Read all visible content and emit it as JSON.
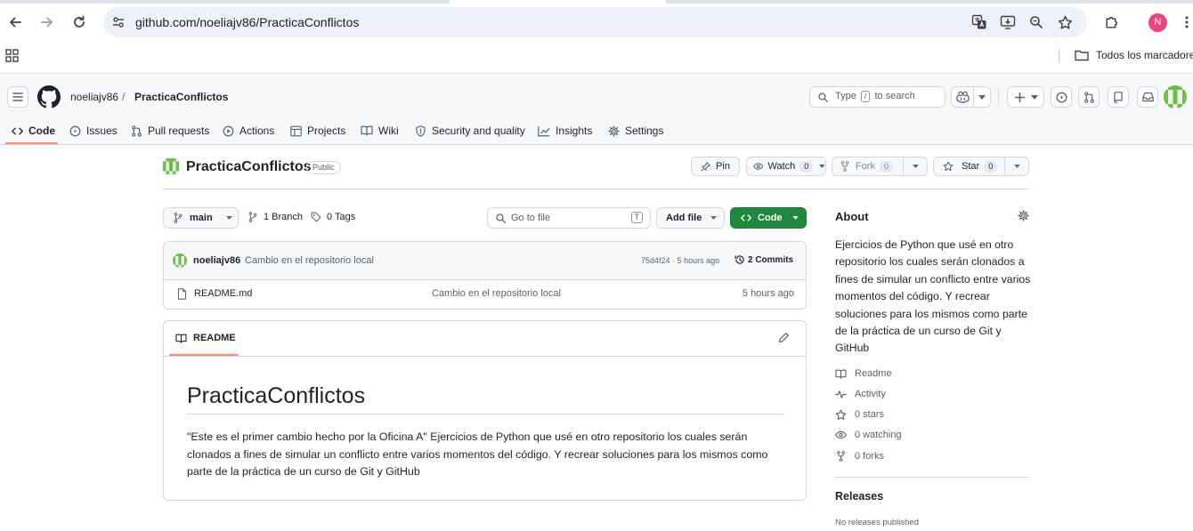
{
  "browser": {
    "url": "github.com/noeliajv86/PracticaConflictos",
    "profile_initial": "N",
    "bookmarks_folder": "Todos los marcadore"
  },
  "header": {
    "owner": "noeliajv86",
    "separator": "/",
    "repo": "PracticaConflictos",
    "search": {
      "prefix": "Type",
      "key": "/",
      "suffix": "to search"
    }
  },
  "repo_nav": {
    "tabs": [
      {
        "label": "Code",
        "icon": "code-icon"
      },
      {
        "label": "Issues",
        "icon": "issue-icon"
      },
      {
        "label": "Pull requests",
        "icon": "pull-request-icon"
      },
      {
        "label": "Actions",
        "icon": "play-icon"
      },
      {
        "label": "Projects",
        "icon": "table-icon"
      },
      {
        "label": "Wiki",
        "icon": "book-icon"
      },
      {
        "label": "Security and quality",
        "icon": "shield-icon"
      },
      {
        "label": "Insights",
        "icon": "graph-icon"
      },
      {
        "label": "Settings",
        "icon": "gear-icon"
      }
    ]
  },
  "repo": {
    "name": "PracticaConflictos",
    "visibility": "Public",
    "pin_label": "Pin",
    "watch_label": "Watch",
    "watch_count": "0",
    "fork_label": "Fork",
    "fork_count": "0",
    "star_label": "Star",
    "star_count": "0"
  },
  "toolbar": {
    "branch": "main",
    "branches": "1 Branch",
    "tags": "0 Tags",
    "go_to_file": "Go to file",
    "go_to_file_key": "T",
    "add_file": "Add file",
    "code": "Code"
  },
  "latest_commit": {
    "author": "noeliajv86",
    "message": "Cambio en el repositorio local",
    "sha": "75d4f24",
    "sep": "·",
    "time": "5 hours ago",
    "commits": "2 Commits"
  },
  "files": [
    {
      "name": "README.md",
      "message": "Cambio en el repositorio local",
      "time": "5 hours ago"
    }
  ],
  "readme": {
    "tab_label": "README",
    "heading": "PracticaConflictos",
    "body": "\"Este es el primer cambio hecho por la Oficina A\" Ejercicios de Python que usé en otro repositorio los cuales serán clonados a fines de simular un conflicto entre varios momentos del código. Y recrear soluciones para los mismos como parte de la práctica de un curso de Git y GitHub"
  },
  "about": {
    "title": "About",
    "description": "Ejercicios de Python que usé en otro repositorio los cuales serán clonados a fines de simular un conflicto entre varios momentos del código. Y recrear soluciones para los mismos como parte de la práctica de un curso de Git y GitHub",
    "items": [
      {
        "label": "Readme",
        "icon": "book-icon"
      },
      {
        "label": "Activity",
        "icon": "pulse-icon"
      },
      {
        "label": "0 stars",
        "icon": "star-icon"
      },
      {
        "label": "0 watching",
        "icon": "eye-icon"
      },
      {
        "label": "0 forks",
        "icon": "fork-icon"
      }
    ]
  },
  "releases": {
    "title": "Releases",
    "empty": "No releases published"
  },
  "colors": {
    "primary_button": "#1f883d",
    "tab_underline": "#fd8c73",
    "avatar_green": "#5cb85c",
    "profile_pink": "#e8467b"
  }
}
